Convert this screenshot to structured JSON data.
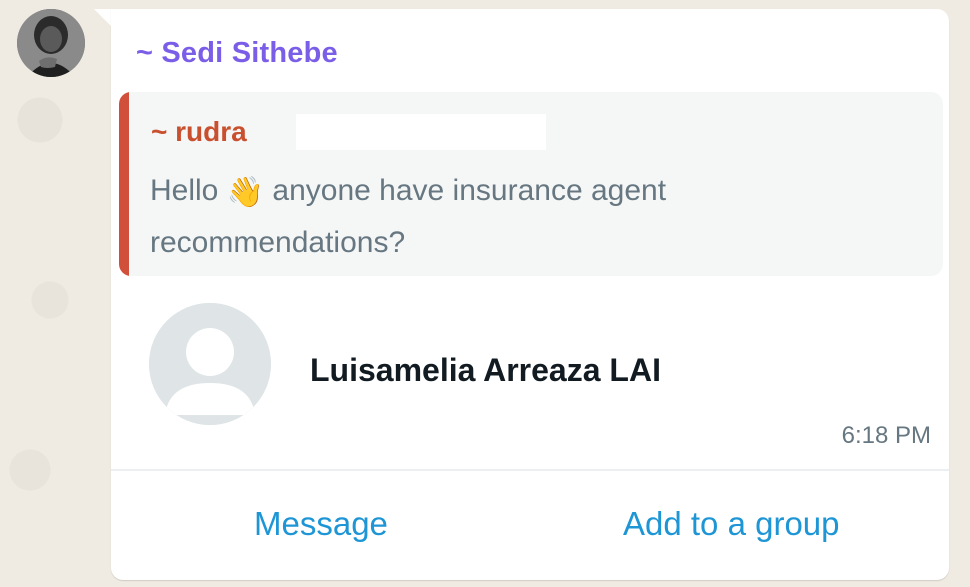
{
  "message": {
    "sender_name": "~ Sedi Sithebe",
    "quoted": {
      "author": "~ rudra",
      "text_before": "Hello ",
      "emoji": "👋",
      "text_after": " anyone have insurance agent recommendations?"
    },
    "contact_card": {
      "name": "Luisamelia Arreaza LAI",
      "avatar_icon": "default-person-avatar-icon"
    },
    "time": "6:18 PM"
  },
  "actions": {
    "message_label": "Message",
    "add_to_group_label": "Add to a group"
  },
  "colors": {
    "sender": "#7b5ee8",
    "quote_author": "#c9502e",
    "quote_bar": "#d1503b",
    "link": "#1e96d6",
    "chat_background": "#efeae2"
  }
}
